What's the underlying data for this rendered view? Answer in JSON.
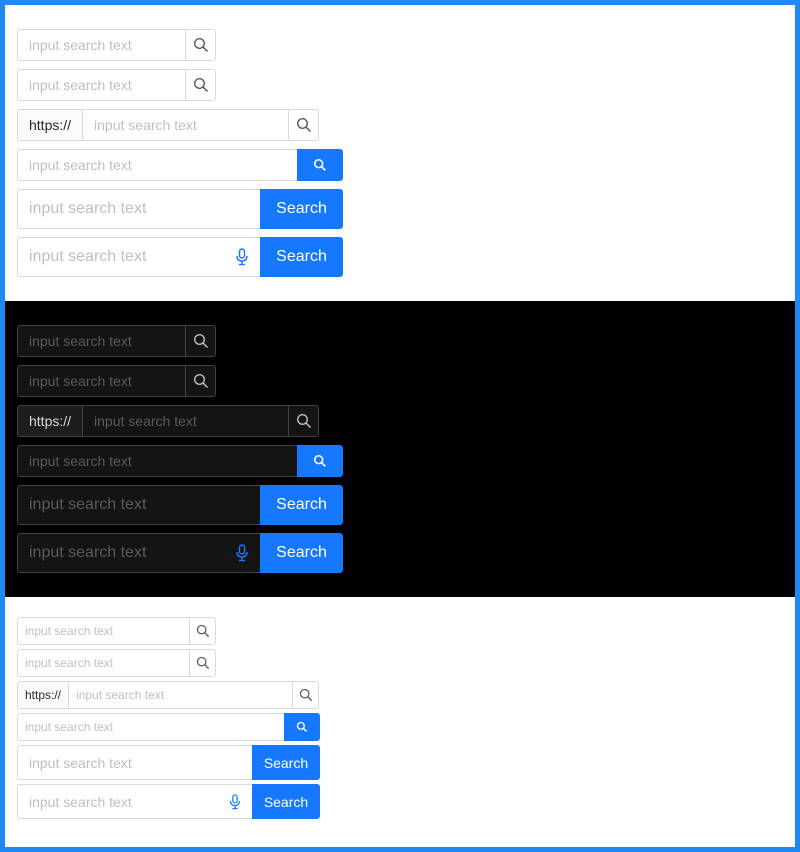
{
  "placeholder": "input search text",
  "addon_label": "https://",
  "search_label": "Search",
  "colors": {
    "primary": "#1677ff",
    "frame": "#1e88f5"
  },
  "icons": {
    "search": "search-icon",
    "mic": "microphone-icon"
  }
}
